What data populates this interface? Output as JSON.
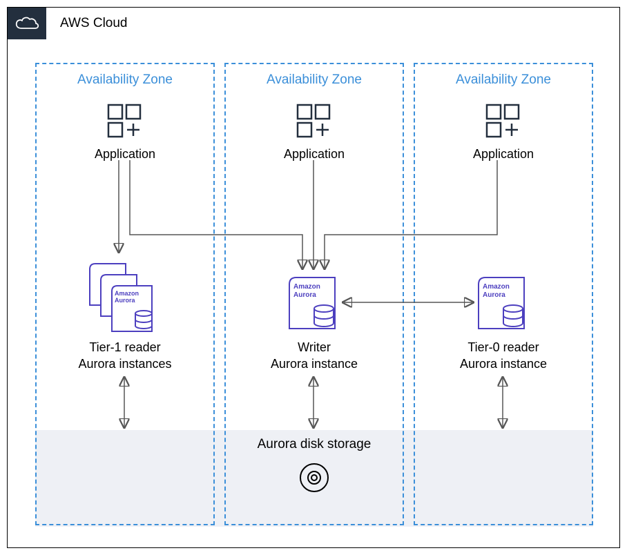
{
  "cloud": {
    "title": "AWS Cloud"
  },
  "zones": [
    {
      "title": "Availability Zone",
      "app_label": "Application",
      "aurora_label_line1": "Tier-1 reader",
      "aurora_label_line2": "Aurora instances",
      "aurora_stack": 3
    },
    {
      "title": "Availability Zone",
      "app_label": "Application",
      "aurora_label_line1": "Writer",
      "aurora_label_line2": "Aurora instance",
      "aurora_stack": 1
    },
    {
      "title": "Availability Zone",
      "app_label": "Application",
      "aurora_label_line1": "Tier-0 reader",
      "aurora_label_line2": "Aurora instance",
      "aurora_stack": 1
    }
  ],
  "storage": {
    "title": "Aurora disk storage"
  },
  "icons": {
    "aurora_text1": "Amazon",
    "aurora_text2": "Aurora"
  },
  "colors": {
    "az_border": "#3b8fd9",
    "aurora": "#4c3fbf",
    "arrow": "#555555",
    "storage_bg": "#eef0f5",
    "badge_bg": "#232f3e"
  }
}
